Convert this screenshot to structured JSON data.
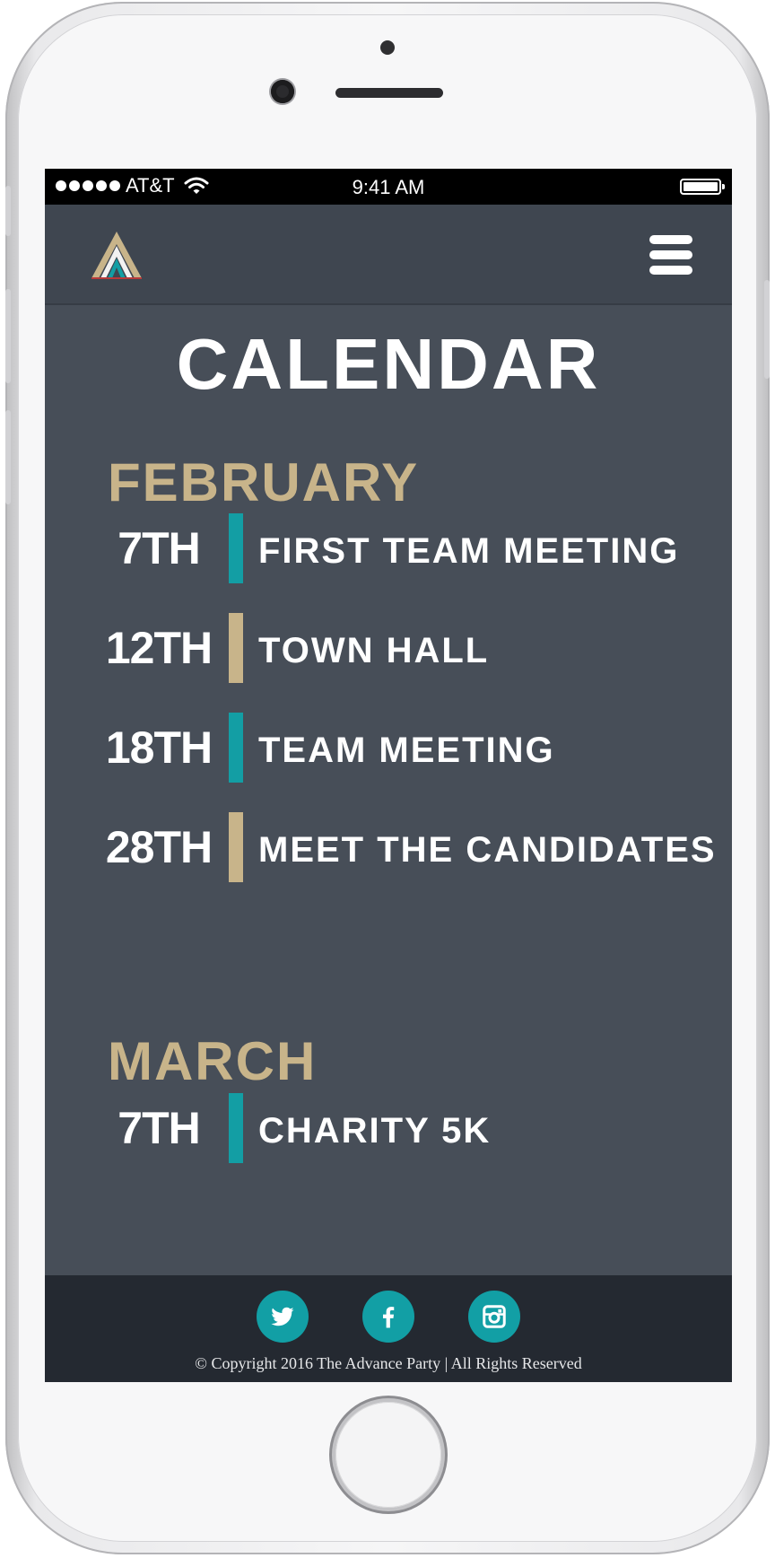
{
  "status_bar": {
    "carrier": "AT&T",
    "time": "9:41 AM"
  },
  "nav": {
    "logo_icon": "advance-party-logo-icon",
    "menu_icon": "hamburger-menu-icon"
  },
  "page": {
    "title": "CALENDAR"
  },
  "months": [
    {
      "name": "FEBRUARY",
      "events": [
        {
          "date": "7TH",
          "title": "FIRST TEAM MEETING",
          "accent": "#139ea4"
        },
        {
          "date": "12TH",
          "title": "TOWN HALL",
          "accent": "#c8b48a"
        },
        {
          "date": "18TH",
          "title": "TEAM MEETING",
          "accent": "#139ea4"
        },
        {
          "date": "28TH",
          "title": "MEET THE CANDIDATES",
          "accent": "#c8b48a"
        }
      ]
    },
    {
      "name": "MARCH",
      "events": [
        {
          "date": "7TH",
          "title": "CHARITY 5K",
          "accent": "#139ea4"
        }
      ]
    }
  ],
  "footer": {
    "social": [
      {
        "icon": "twitter-icon"
      },
      {
        "icon": "facebook-icon"
      },
      {
        "icon": "instagram-icon"
      }
    ],
    "copyright": "© Copyright 2016 The Advance Party | All Rights Reserved"
  },
  "colors": {
    "background": "#474e58",
    "nav": "#3f4650",
    "footer": "#242931",
    "teal": "#139ea4",
    "gold": "#c8b48a"
  }
}
